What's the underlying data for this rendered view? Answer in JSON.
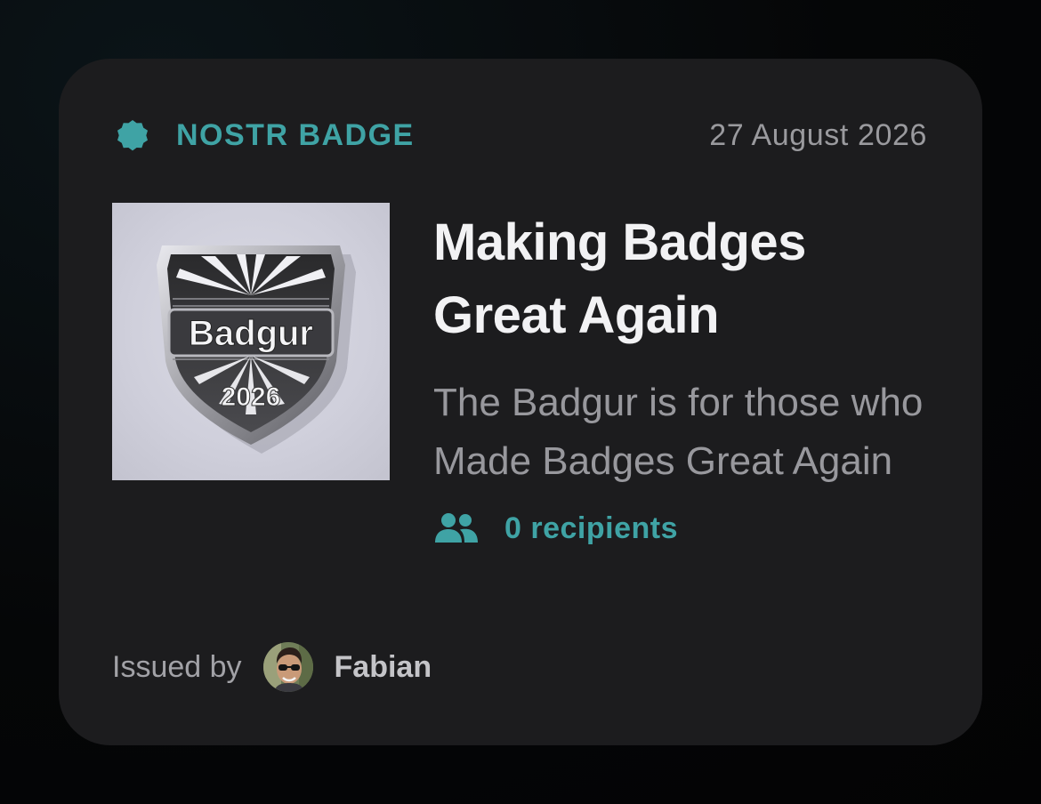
{
  "badge": {
    "type_label": "NOSTR BADGE",
    "date": "27 August 2026",
    "title": "Making Badges Great Again",
    "description": "The Badgur is for those who Made Badges Great Again",
    "recipients_label": "0 recipients",
    "image": {
      "emblem_name": "Badgur",
      "emblem_year": "2026"
    }
  },
  "issuer": {
    "prefix": "Issued by",
    "name": "Fabian"
  },
  "icons": {
    "type_tag": "seal-icon",
    "recipients": "people-icon",
    "issuer": "avatar"
  },
  "colors": {
    "accent": "#3fa3a5",
    "card_background": "#1c1c1e",
    "title": "#f2f2f4",
    "muted_text": "#98989d"
  }
}
